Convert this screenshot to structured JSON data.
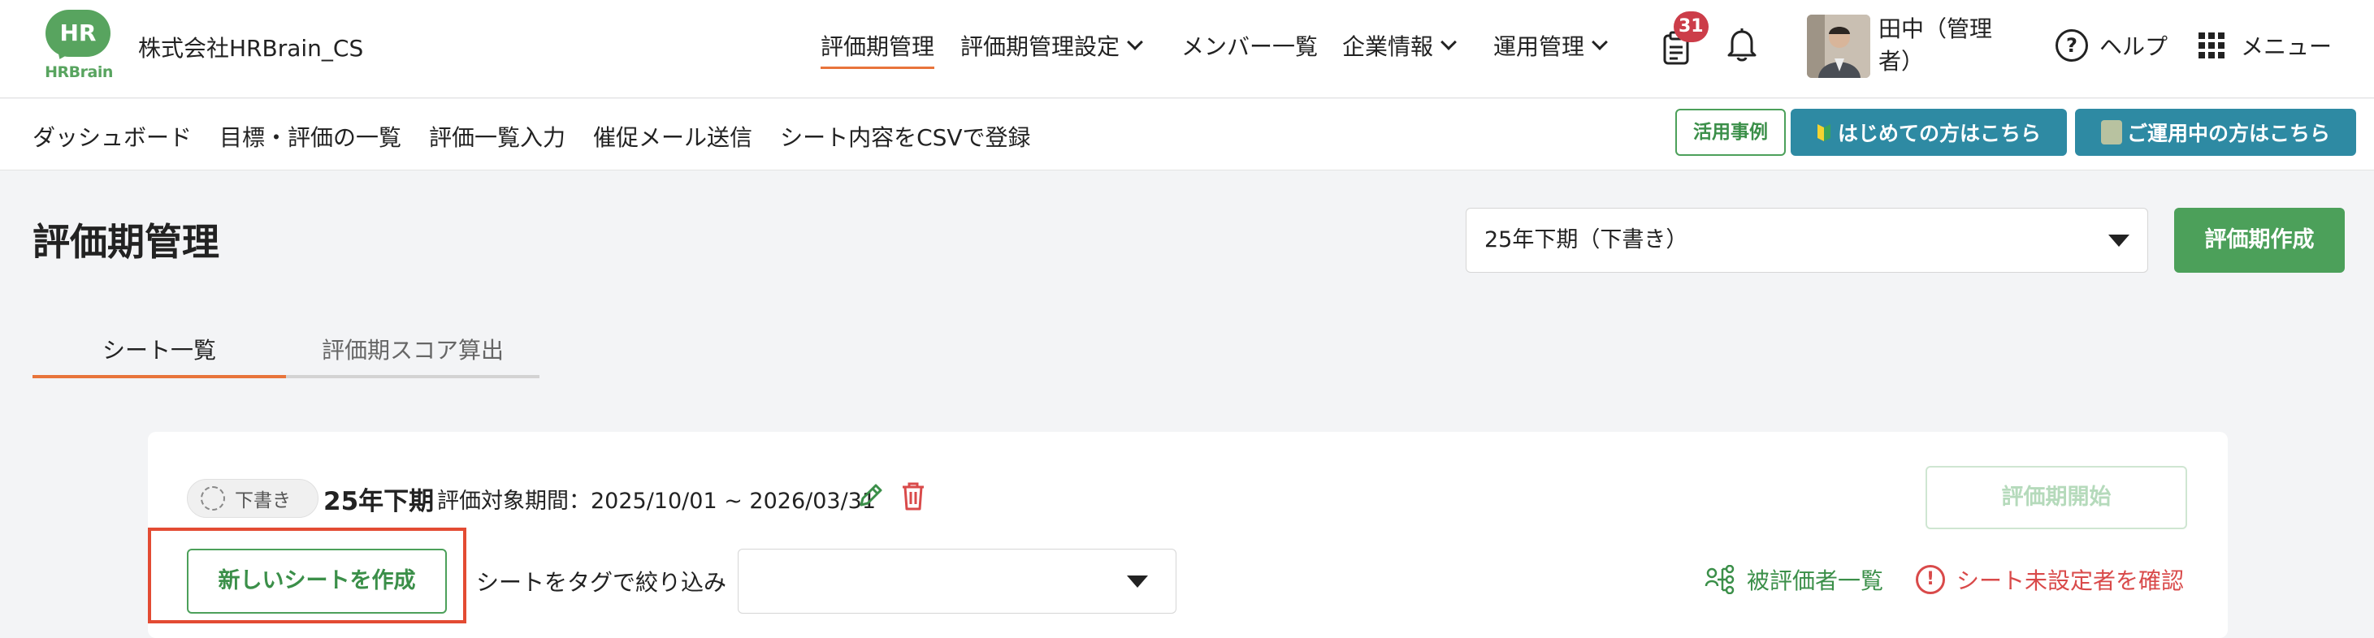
{
  "header": {
    "logo_top": "HR",
    "logo_brand": "HRBrain",
    "company": "株式会社HRBrain_CS",
    "nav": [
      {
        "label": "評価期管理",
        "active": true
      },
      {
        "label": "評価期管理設定",
        "dropdown": true
      },
      {
        "label": "メンバー一覧"
      },
      {
        "label": "企業情報",
        "dropdown": true
      },
      {
        "label": "運用管理",
        "dropdown": true
      }
    ],
    "notification_count": "31",
    "user_name": "田中（管理者）",
    "help_label": "ヘルプ",
    "menu_label": "メニュー",
    "icons": [
      "document-icon",
      "bell-icon",
      "help-icon",
      "grid-menu-icon"
    ]
  },
  "subnav": {
    "items": [
      "ダッシュボード",
      "目標・評価の一覧",
      "評価一覧入力",
      "催促メール送信",
      "シート内容をCSVで登録"
    ],
    "case_button": "活用事例",
    "first_time_button": "はじめての方はこちら",
    "in_use_button": "ご運用中の方はこちら"
  },
  "page": {
    "title": "評価期管理",
    "period_select": "25年下期（下書き）",
    "create_period_button": "評価期作成"
  },
  "tabs": [
    {
      "label": "シート一覧",
      "active": true
    },
    {
      "label": "評価期スコア算出",
      "active": false
    }
  ],
  "card": {
    "status": "下書き",
    "period_name": "25年下期",
    "period_range": "評価対象期間：2025/10/01 ~ 2026/03/31",
    "start_button": "評価期開始",
    "new_sheet_button": "新しいシートを作成",
    "filter_label": "シートをタグで絞り込み",
    "tag_select_value": "",
    "evaluatee_link": "被評価者一覧",
    "unset_link": "シート未設定者を確認"
  },
  "colors": {
    "brand_green": "#4ca05a",
    "accent_orange": "#e8743b",
    "teal": "#2e8aa3",
    "badge_red": "#cc3d49",
    "warning_red": "#d94a4a",
    "highlight_red": "#e34b33"
  }
}
